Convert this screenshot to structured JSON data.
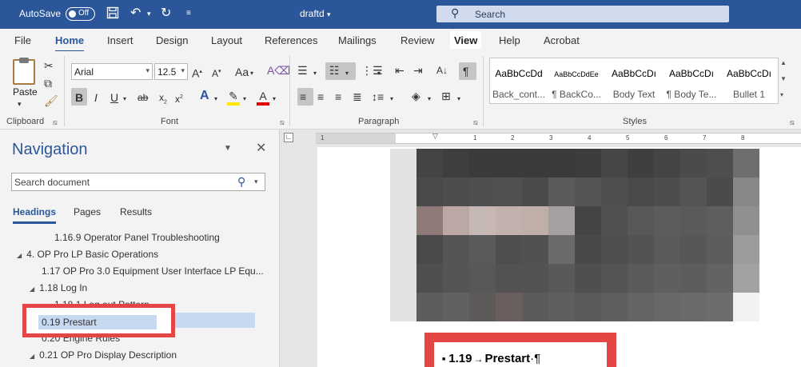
{
  "titlebar": {
    "autosave_label": "AutoSave",
    "autosave_state": "Off",
    "document_name": "draftd",
    "search_placeholder": "Search"
  },
  "tabs": [
    "File",
    "Home",
    "Insert",
    "Design",
    "Layout",
    "References",
    "Mailings",
    "Review",
    "View",
    "Help",
    "Acrobat"
  ],
  "active_tab": "Home",
  "ribbon": {
    "clipboard": {
      "paste_label": "Paste",
      "group_label": "Clipboard"
    },
    "font": {
      "font_name": "Arial",
      "font_size": "12.5",
      "group_label": "Font"
    },
    "paragraph": {
      "group_label": "Paragraph"
    },
    "styles": {
      "group_label": "Styles",
      "items": [
        {
          "sample": "AaBbCcDd",
          "name": "Back_cont..."
        },
        {
          "sample": "AaBbCcDdEe",
          "name": "¶ BackCo..."
        },
        {
          "sample": "AaBbCcDı",
          "name": "Body Text"
        },
        {
          "sample": "AaBbCcDı",
          "name": "¶ Body Te..."
        },
        {
          "sample": "AaBbCcDı",
          "name": "Bullet 1"
        }
      ]
    }
  },
  "navigation": {
    "title": "Navigation",
    "search_placeholder": "Search document",
    "tabs": [
      "Headings",
      "Pages",
      "Results"
    ],
    "active_tab": "Headings",
    "items": [
      {
        "text": "1.16.9 Operator Panel Troubleshooting",
        "expander": ""
      },
      {
        "text": "4. OP Pro LP Basic Operations",
        "expander": "◢"
      },
      {
        "text": "1.17 OP Pro 3.0 Equipment User Interface LP Equ...",
        "expander": ""
      },
      {
        "text": "1.18 Log In",
        "expander": "◢"
      },
      {
        "text": "1.18.1 Log out Pattern",
        "expander": ""
      },
      {
        "text": "0.19 Prestart",
        "expander": ""
      },
      {
        "text": "0.20 Engine Rules",
        "expander": ""
      },
      {
        "text": "0.21 OP Pro Display Description",
        "expander": "◢"
      }
    ]
  },
  "document": {
    "heading_number": "1.19",
    "heading_arrow": "→",
    "heading_title": "Prestart",
    "heading_marks": "·¶"
  },
  "ruler": {
    "labels": [
      "1",
      "1",
      "2",
      "3",
      "4",
      "5",
      "6",
      "7",
      "8"
    ]
  },
  "colors": {
    "title_bar": "#2b579a",
    "accent": "#2b579a",
    "highlight_red": "#e44545",
    "nav_selection": "#c6d9f0"
  }
}
